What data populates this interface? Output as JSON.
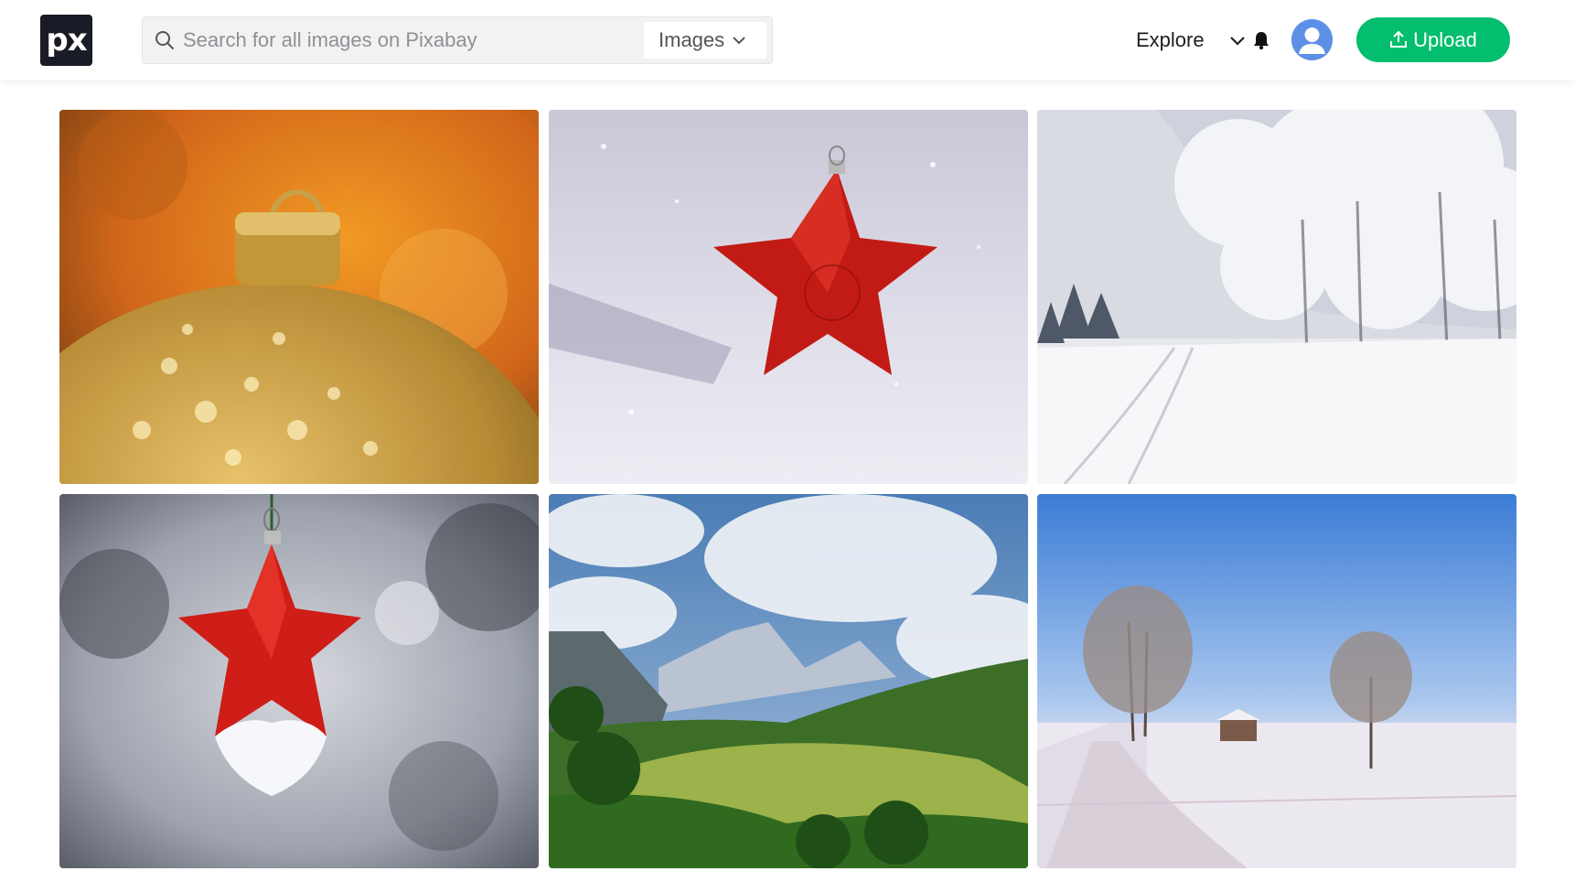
{
  "header": {
    "logo_text": "px",
    "search": {
      "placeholder": "Search for all images on Pixabay",
      "value": "",
      "type_selected": "Images"
    },
    "explore_label": "Explore",
    "upload_label": "Upload"
  },
  "colors": {
    "upload_button": "#02be6e",
    "logo_bg": "#191b26",
    "avatar_bg": "#5c8fe6"
  },
  "icons": [
    "search-icon",
    "chevron-down-icon",
    "bell-icon",
    "user-avatar-icon",
    "upload-icon"
  ],
  "gallery": {
    "photos": [
      {
        "subject": "gold-christmas-bauble"
      },
      {
        "subject": "red-star-ornament-in-snow"
      },
      {
        "subject": "snowy-trees-winter-path"
      },
      {
        "subject": "red-star-ornament-hanging"
      },
      {
        "subject": "green-valley-mountains"
      },
      {
        "subject": "snowy-road-trees-house"
      }
    ]
  }
}
